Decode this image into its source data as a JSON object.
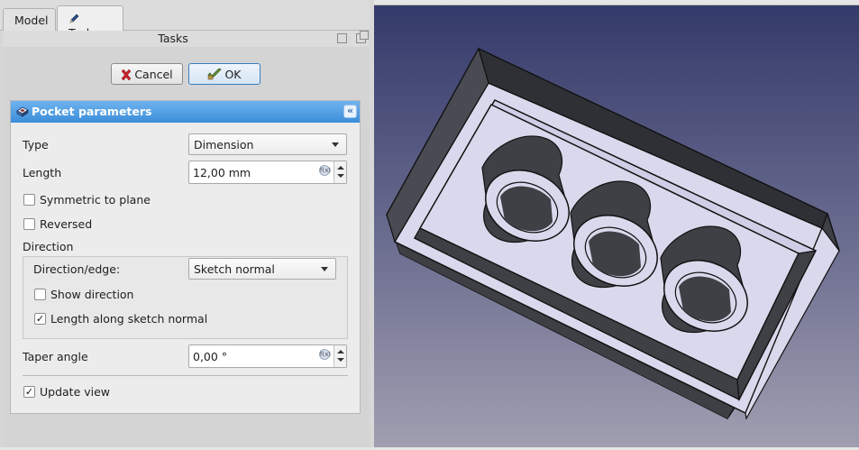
{
  "tabs": {
    "model": "Model",
    "tasks": "Tasks"
  },
  "panel_title": "Tasks",
  "buttons": {
    "cancel": "Cancel",
    "ok": "OK"
  },
  "pocket": {
    "header": "Pocket parameters",
    "type_label": "Type",
    "type_value": "Dimension",
    "length_label": "Length",
    "length_value": "12,00 mm",
    "symmetric_label": "Symmetric to plane",
    "symmetric_checked": false,
    "reversed_label": "Reversed",
    "reversed_checked": false,
    "direction_label": "Direction",
    "direction_edge_label": "Direction/edge:",
    "direction_edge_value": "Sketch normal",
    "show_direction_label": "Show direction",
    "show_direction_checked": false,
    "along_normal_label": "Length along sketch normal",
    "along_normal_checked": true,
    "taper_label": "Taper angle",
    "taper_value": "0,00 °",
    "update_view_label": "Update view",
    "update_view_checked": true
  },
  "icons": {
    "tasks_tab": "pencil-icon",
    "cancel": "red-x-icon",
    "ok": "green-check-icon",
    "header": "pocket-icon",
    "collapse": "double-chevron-up-icon",
    "expression": "fx-expression-icon"
  },
  "colors": {
    "header_blue": "#3b8dd9",
    "view_bg_top": "#343a6a",
    "view_bg_bottom": "#a09eb0",
    "part_face": "#d9d8ec",
    "part_dark": "#3f4046"
  }
}
